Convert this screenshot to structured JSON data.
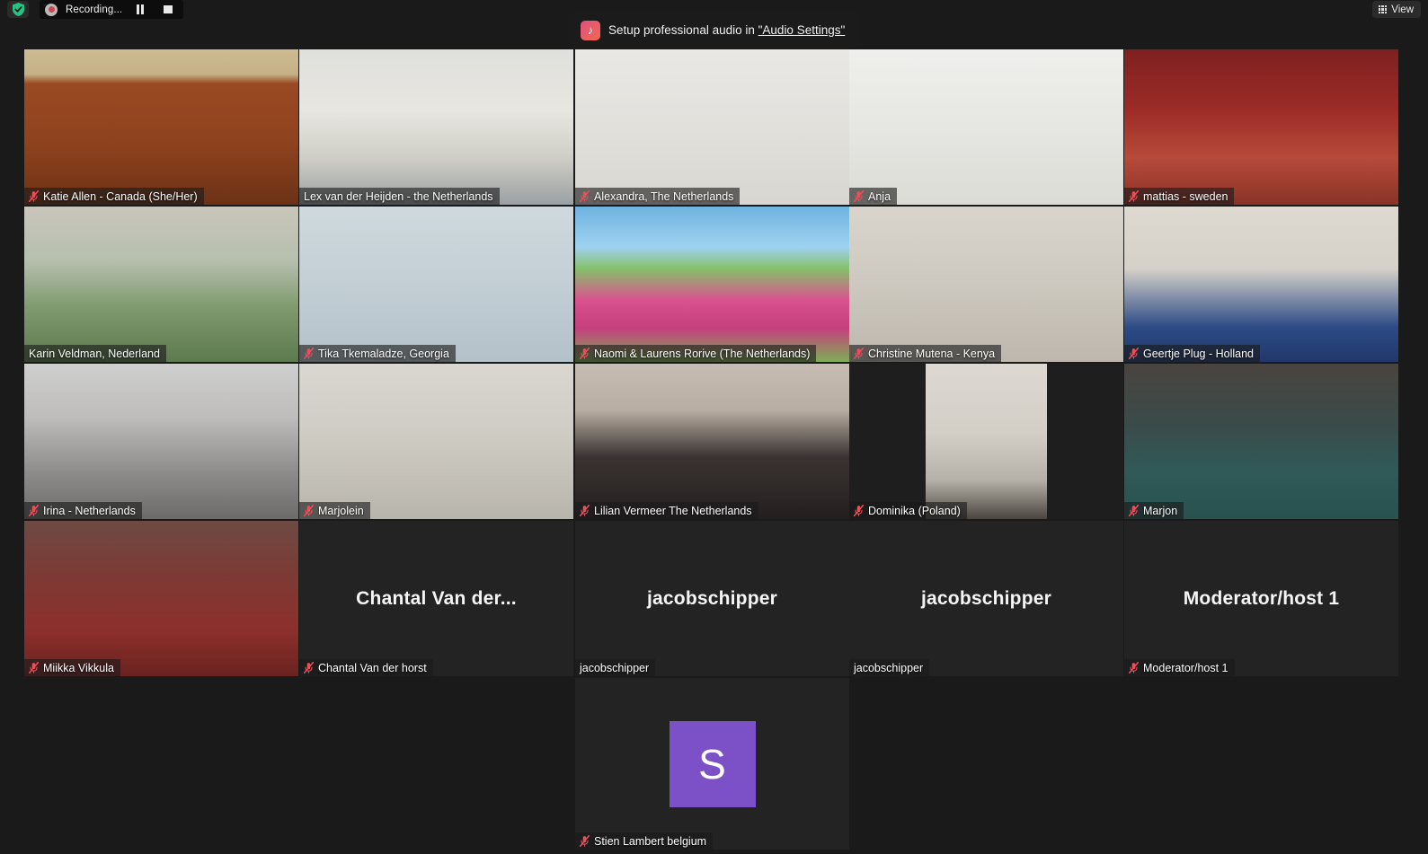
{
  "topbar": {
    "shield_icon": "shield-check-icon",
    "recording_label": "Recording...",
    "record_icon": "record-dot-icon",
    "pause_icon": "pause-icon",
    "stop_icon": "stop-icon",
    "view_label": "View",
    "view_icon": "grid-icon"
  },
  "banner": {
    "icon": "music-note-icon",
    "text_before": "Setup professional audio in ",
    "link_text": "\"Audio Settings\""
  },
  "colors": {
    "active_speaker_border": "#cdea4b",
    "avatar_purple": "#7c51c8",
    "mute_red": "#e8505b",
    "app_background": "#1a1a1a"
  },
  "gallery": {
    "rows": 4,
    "columns": 5,
    "tiles": [
      {
        "name": "Katie Allen - Canada (She/Her)",
        "muted": true,
        "active": false,
        "kind": "video",
        "bg": "katie",
        "row": 1,
        "col": 1
      },
      {
        "name": "Lex van der Heijden - the Netherlands",
        "muted": false,
        "active": true,
        "kind": "video",
        "bg": "lex",
        "row": 1,
        "col": 2
      },
      {
        "name": "Alexandra, The Netherlands",
        "muted": true,
        "active": false,
        "kind": "video",
        "bg": "alexandra",
        "row": 1,
        "col": 3
      },
      {
        "name": "Anja",
        "muted": true,
        "active": false,
        "kind": "video",
        "bg": "anja",
        "row": 1,
        "col": 4
      },
      {
        "name": "mattias - sweden",
        "muted": true,
        "active": false,
        "kind": "video",
        "bg": "mattias",
        "row": 1,
        "col": 5
      },
      {
        "name": "Karin Veldman, Nederland",
        "muted": false,
        "active": false,
        "kind": "video",
        "bg": "karin",
        "row": 2,
        "col": 1
      },
      {
        "name": "Tika Tkemaladze, Georgia",
        "muted": true,
        "active": false,
        "kind": "video",
        "bg": "tika",
        "row": 2,
        "col": 2
      },
      {
        "name": "Naomi & Laurens Rorive (The Netherlands)",
        "muted": true,
        "active": false,
        "kind": "video",
        "bg": "naomi",
        "row": 2,
        "col": 3
      },
      {
        "name": "Christine Mutena - Kenya",
        "muted": true,
        "active": false,
        "kind": "video",
        "bg": "christine",
        "row": 2,
        "col": 4
      },
      {
        "name": "Geertje Plug - Holland",
        "muted": true,
        "active": false,
        "kind": "video",
        "bg": "geertje",
        "row": 2,
        "col": 5
      },
      {
        "name": "Irina - Netherlands",
        "muted": true,
        "active": false,
        "kind": "video",
        "bg": "irina",
        "row": 3,
        "col": 1
      },
      {
        "name": "Marjolein",
        "muted": true,
        "active": false,
        "kind": "video",
        "bg": "marjolein",
        "row": 3,
        "col": 2
      },
      {
        "name": "Lilian Vermeer The Netherlands",
        "muted": true,
        "active": false,
        "kind": "video",
        "bg": "lilian",
        "row": 3,
        "col": 3
      },
      {
        "name": "Dominika (Poland)",
        "muted": true,
        "active": false,
        "kind": "video-narrow",
        "bg": "dominika",
        "row": 3,
        "col": 4
      },
      {
        "name": "Marjon",
        "muted": true,
        "active": false,
        "kind": "video",
        "bg": "marjon",
        "row": 3,
        "col": 5
      },
      {
        "name": "Miikka Vikkula",
        "muted": true,
        "active": false,
        "kind": "video",
        "bg": "miikka",
        "row": 4,
        "col": 1
      },
      {
        "name": "Chantal Van der horst",
        "display_name": "Chantal Van der...",
        "muted": true,
        "active": false,
        "kind": "name",
        "row": 4,
        "col": 2
      },
      {
        "name": "jacobschipper",
        "display_name": "jacobschipper",
        "muted": false,
        "active": false,
        "kind": "name",
        "row": 4,
        "col": 3
      },
      {
        "name": "jacobschipper",
        "display_name": "jacobschipper",
        "muted": false,
        "active": false,
        "kind": "name",
        "row": 4,
        "col": 4
      },
      {
        "name": "Moderator/host 1",
        "display_name": "Moderator/host 1",
        "muted": true,
        "active": false,
        "kind": "name",
        "row": 4,
        "col": 5
      },
      {
        "name": "Stien Lambert belgium",
        "avatar_letter": "S",
        "muted": true,
        "active": false,
        "kind": "avatar",
        "row": 5,
        "col": 3
      }
    ]
  }
}
